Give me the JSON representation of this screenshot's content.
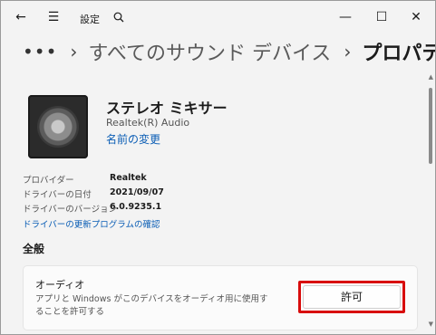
{
  "titlebar": {
    "title": "設定",
    "back_icon": "back-arrow-icon",
    "menu_icon": "hamburger-icon",
    "search_icon": "search-icon",
    "minimize": "—",
    "maximize": "☐",
    "close": "✕"
  },
  "breadcrumb": {
    "more": "•••",
    "items": [
      "すべてのサウンド デバイス"
    ],
    "current": "プロパティ",
    "separator": "›"
  },
  "device": {
    "name": "ステレオ ミキサー",
    "subtitle": "Realtek(R) Audio",
    "rename_link": "名前の変更",
    "icon": "speaker-icon"
  },
  "properties": [
    {
      "label": "プロバイダー",
      "value": "Realtek"
    },
    {
      "label": "ドライバーの日付",
      "value": "2021/09/07"
    },
    {
      "label": "ドライバーのバージョン",
      "value": "6.0.9235.1"
    }
  ],
  "driver_link": "ドライバーの更新プログラムの確認",
  "section": {
    "title": "全般"
  },
  "audio_card": {
    "title": "オーディオ",
    "description": "アプリと Windows がこのデバイスをオーディオ用に使用することを許可する",
    "button_label": "許可"
  },
  "colors": {
    "accent_link": "#0a5db5",
    "highlight": "#d80c0c",
    "background": "#f3f3f3"
  }
}
